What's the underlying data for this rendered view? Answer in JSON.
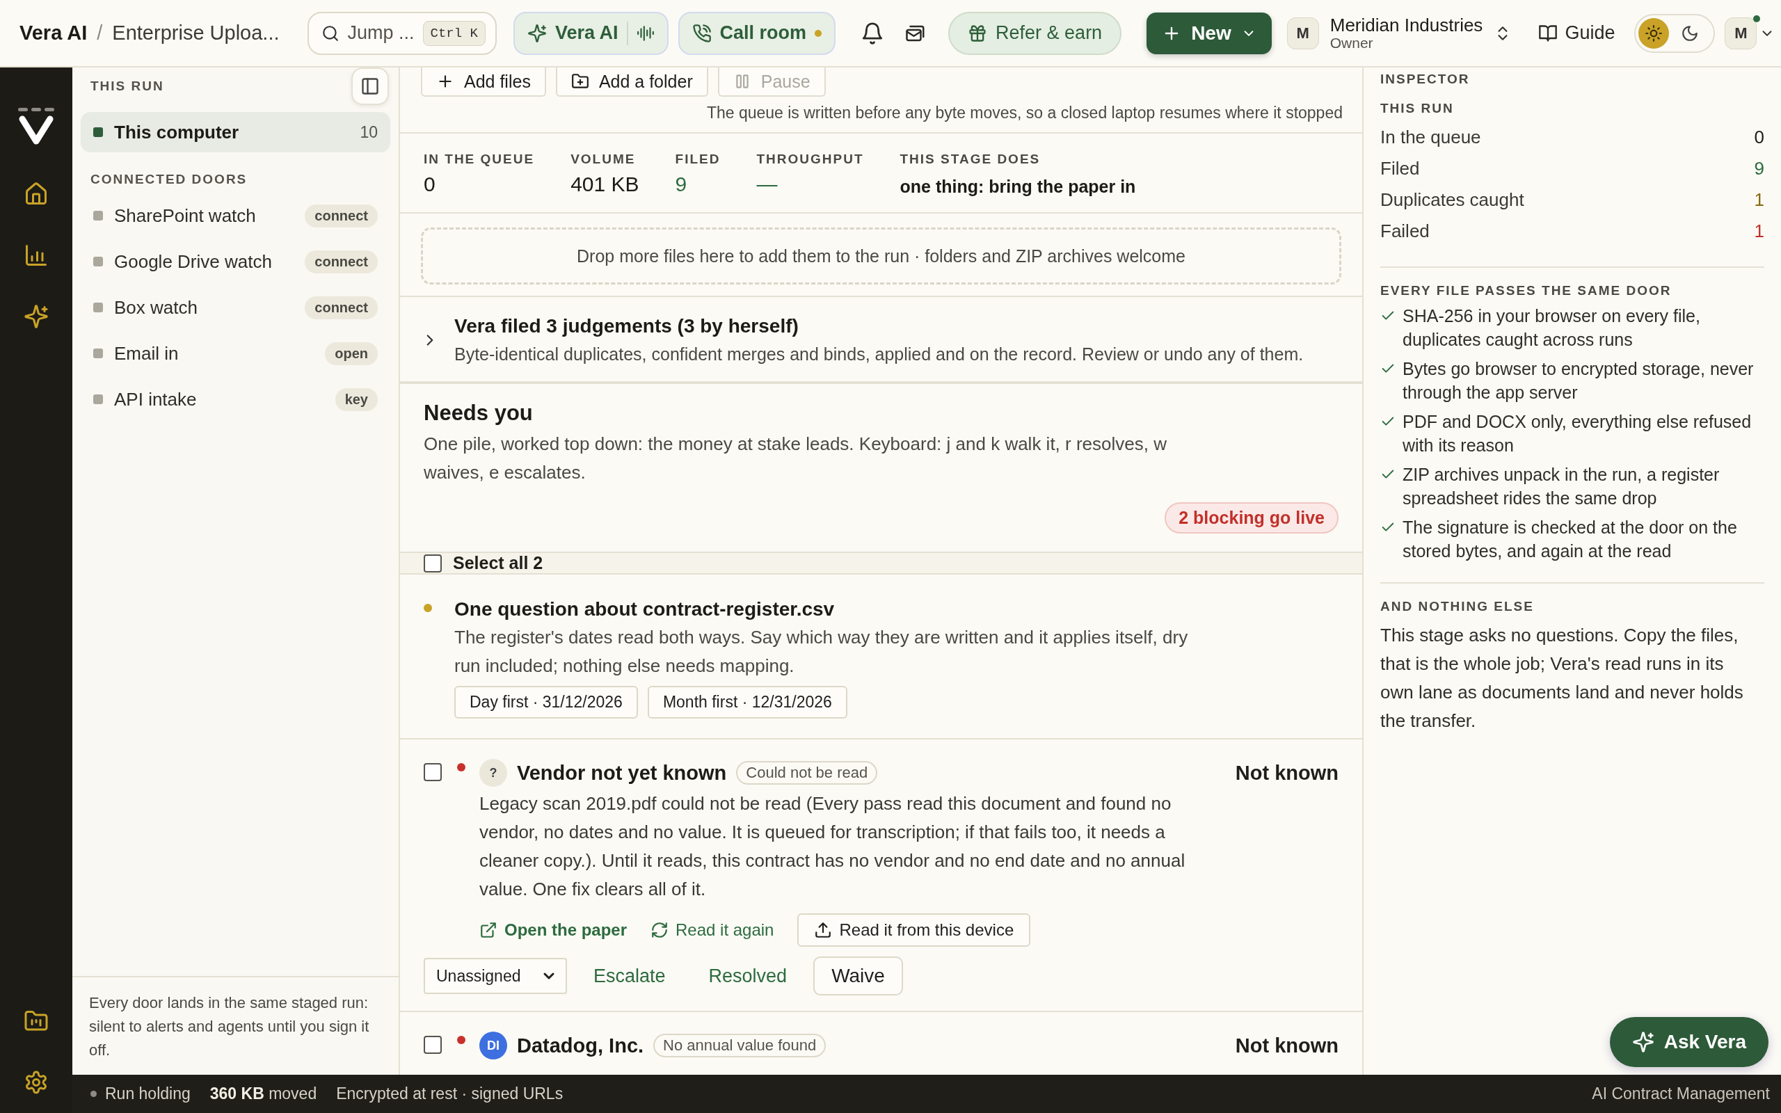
{
  "breadcrumb": {
    "app": "Vera AI",
    "separator": "/",
    "page": "Enterprise Uploa..."
  },
  "search": {
    "placeholder": "Jump ...",
    "shortcut": "Ctrl K"
  },
  "vera_button": {
    "label": "Vera AI"
  },
  "call_button": {
    "label": "Call room",
    "live": true
  },
  "refer_button": {
    "label": "Refer & earn"
  },
  "new_button": {
    "label": "New"
  },
  "workspace": {
    "initial": "M",
    "name": "Meridian Industries",
    "role": "Owner"
  },
  "guide": {
    "label": "Guide"
  },
  "theme": [
    {
      "kind": "light",
      "selected": true
    },
    {
      "kind": "dark",
      "selected": false
    }
  ],
  "user": {
    "initial": "M",
    "online": true
  },
  "sidebar": {
    "sections": [
      {
        "title": "THIS RUN",
        "items": [
          {
            "label": "This computer",
            "count": "10",
            "active": true,
            "selected": true
          }
        ]
      },
      {
        "title": "CONNECTED DOORS",
        "items": [
          {
            "label": "SharePoint watch",
            "action": "connect",
            "active": false,
            "selected": false
          },
          {
            "label": "Google Drive watch",
            "action": "connect",
            "active": false,
            "selected": false
          },
          {
            "label": "Box watch",
            "action": "connect",
            "active": false,
            "selected": false
          },
          {
            "label": "Email in",
            "action": "open",
            "active": false,
            "selected": false
          },
          {
            "label": "API intake",
            "action": "key",
            "active": false,
            "selected": false
          }
        ]
      }
    ],
    "footnote": "Every door lands in the same staged run: silent to alerts and agents until you sign it off."
  },
  "toolbar": [
    {
      "label": "Add files",
      "kind": "add-files",
      "disabled": false
    },
    {
      "label": "Add a folder",
      "kind": "add-folder",
      "disabled": false
    },
    {
      "label": "Pause",
      "kind": "pause",
      "disabled": true
    }
  ],
  "queue_note": "The queue is written before any byte moves, so a closed laptop resumes where it stopped",
  "stats": [
    {
      "label": "IN THE QUEUE",
      "value": "0",
      "kind": "number",
      "color": "#1c1b16"
    },
    {
      "label": "VOLUME",
      "value": "401 KB",
      "kind": "number",
      "color": "#1c1b16"
    },
    {
      "label": "FILED",
      "value": "9",
      "kind": "number",
      "color": "#2d6b3f"
    },
    {
      "label": "THROUGHPUT",
      "value": "—",
      "kind": "number",
      "color": "#2d6b3f"
    },
    {
      "label": "THIS STAGE DOES",
      "value": "one thing: bring the paper in",
      "kind": "text",
      "color": "#1c1b16"
    }
  ],
  "dropzone": "Drop more files here to add them to the run · folders and ZIP archives welcome",
  "judgements": {
    "title": "Vera filed 3 judgements (3 by herself)",
    "text": "Byte-identical duplicates, confident merges and binds, applied and on the record. Review or undo any of them.",
    "expanded": false
  },
  "needs_you": {
    "title": "Needs you",
    "text": "One pile, worked top down: the money at stake leads. Keyboard: j and k walk it, r resolves, w waives, e escalates.",
    "blocking": "2 blocking go live",
    "select_all": {
      "label": "Select all 2",
      "checked": false
    }
  },
  "items": [
    {
      "kind": "question",
      "color": "#c9a227",
      "title": "One question about contract-register.csv",
      "text": "The register's dates read both ways. Say which way they are written and it applies itself, dry run included; nothing else needs mapping.",
      "choices": [
        "Day first · 31/12/2026",
        "Month first · 12/31/2026"
      ]
    },
    {
      "kind": "issue",
      "checked": false,
      "color": "#c8312b",
      "avatar": {
        "text": "?",
        "color": "#ebe7da"
      },
      "title": "Vendor not yet known",
      "badge": "Could not be read",
      "amount": "Not known",
      "text": "Legacy scan 2019.pdf could not be read (Every pass read this document and found no vendor, no dates and no value. It is queued for transcription; if that fails too, it needs a cleaner copy.). Until it reads, this contract has no vendor and no end date and no annual value. One fix clears all of it.",
      "links": [
        {
          "label": "Open the paper",
          "kind": "open"
        },
        {
          "label": "Read it again",
          "kind": "reread"
        },
        {
          "label": "Read it from this device",
          "kind": "upload"
        }
      ],
      "assignee": "Unassigned",
      "actions": [
        {
          "label": "Escalate",
          "kind": "link"
        },
        {
          "label": "Resolved",
          "kind": "link"
        },
        {
          "label": "Waive",
          "kind": "button"
        }
      ]
    },
    {
      "kind": "issue",
      "checked": false,
      "color": "#c8312b",
      "avatar": {
        "text": "DI",
        "color": "#3d6fe0"
      },
      "title": "Datadog, Inc.",
      "badge": "No annual value found",
      "amount": "Not known"
    }
  ],
  "inspector": {
    "title": "INSPECTOR",
    "run_title": "THIS RUN",
    "metrics": [
      {
        "label": "In the queue",
        "value": "0",
        "color": "#1c1b16"
      },
      {
        "label": "Filed",
        "value": "9",
        "color": "#2d6b3f"
      },
      {
        "label": "Duplicates caught",
        "value": "1",
        "color": "#8a6a10"
      },
      {
        "label": "Failed",
        "value": "1",
        "color": "#c2302a"
      }
    ],
    "checks_title": "EVERY FILE PASSES THE SAME DOOR",
    "checks": [
      "SHA-256 in your browser on every file, duplicates caught across runs",
      "Bytes go browser to encrypted storage, never through the app server",
      "PDF and DOCX only, everything else refused with its reason",
      "ZIP archives unpack in the run, a register spreadsheet rides the same drop",
      "The signature is checked at the door on the stored bytes, and again at the read"
    ],
    "else_title": "AND NOTHING ELSE",
    "else_text": "This stage asks no questions. Copy the files, that is the whole job; Vera's read runs in its own lane as documents land and never holds the transfer."
  },
  "status_bar": {
    "state": "Run holding",
    "moved": "**360 KB** moved",
    "security": "Encrypted at rest · signed URLs",
    "brand": "AI Contract Management"
  },
  "ask_vera": {
    "label": "Ask Vera"
  }
}
